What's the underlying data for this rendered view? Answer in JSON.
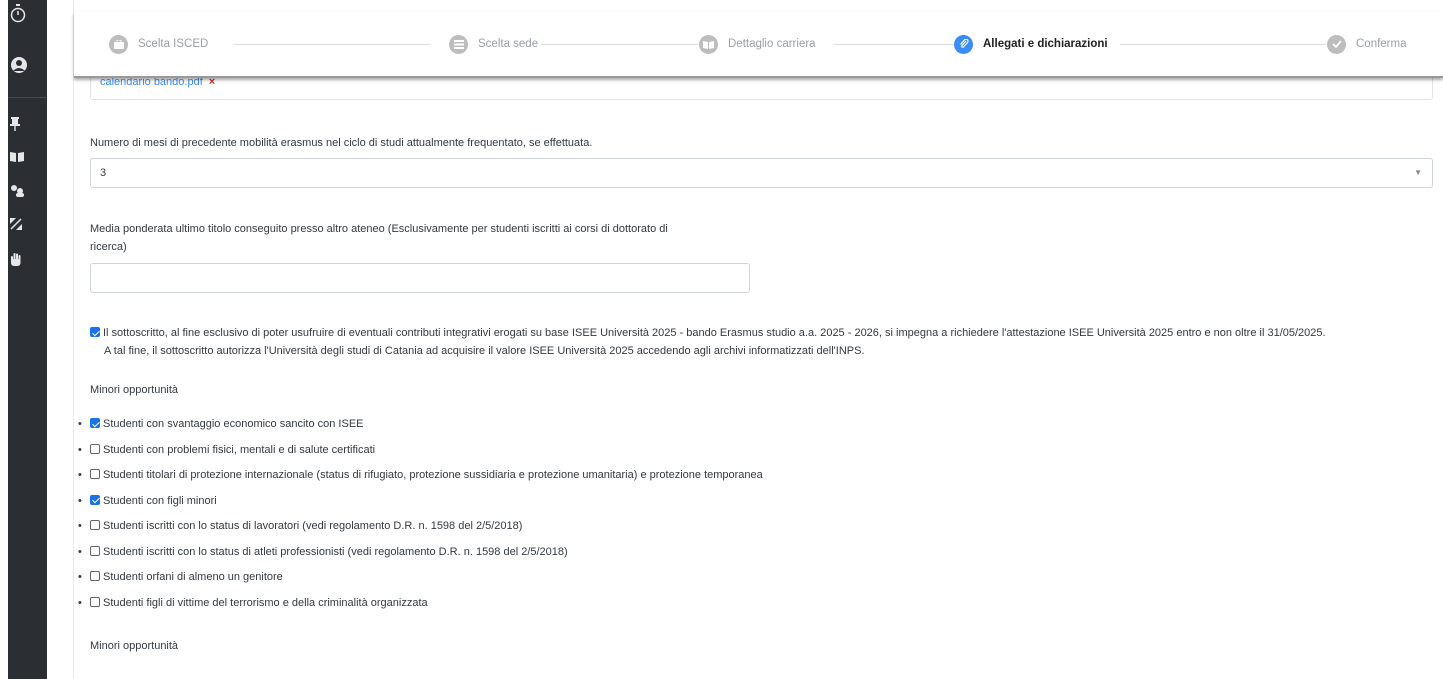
{
  "stepper": {
    "steps": [
      {
        "label": "Scelta ISCED",
        "icon": "briefcase-icon",
        "active": false
      },
      {
        "label": "Scelta sede",
        "icon": "list-icon",
        "active": false
      },
      {
        "label": "Dettaglio carriera",
        "icon": "book-icon",
        "active": false
      },
      {
        "label": "Allegati e dichiarazioni",
        "icon": "paperclip-icon",
        "active": true
      },
      {
        "label": "Conferma",
        "icon": "check-icon",
        "active": false
      }
    ]
  },
  "attachments": {
    "file_name": "calendario bando.pdf",
    "remove_glyph": "×"
  },
  "erasmus_months": {
    "label": "Numero di mesi di precedente mobilità erasmus nel ciclo di studi attualmente frequentato, se effettuata.",
    "value": "3"
  },
  "weighted_average": {
    "label_line1": "Media ponderata ultimo titolo conseguito presso altro ateneo (Esclusivamente per studenti iscritti ai corsi di dottorato di",
    "label_line2": "ricerca)",
    "value": ""
  },
  "declaration": {
    "checked": true,
    "line1": "Il sottoscritto, al fine esclusivo di poter usufruire di eventuali contributi integrativi erogati su base ISEE Università 2025 - bando Erasmus studio a.a. 2025 - 2026, si impegna a richiedere l'attestazione ISEE Università 2025 entro e non oltre il 31/05/2025.",
    "line2": "A tal fine, il sottoscritto autorizza l'Università degli studi di Catania ad acquisire il valore ISEE Università 2025 accedendo agli archivi informatizzati dell'INPS."
  },
  "minori_opportunita": {
    "heading": "Minori opportunità",
    "items": [
      {
        "label": "Studenti con svantaggio economico sancito con ISEE",
        "checked": true
      },
      {
        "label": "Studenti con problemi fisici, mentali e di salute certificati",
        "checked": false
      },
      {
        "label": "Studenti titolari di protezione internazionale (status di rifugiato, protezione sussidiaria e protezione umanitaria) e protezione temporanea",
        "checked": false
      },
      {
        "label": "Studenti con figli minori",
        "checked": true
      },
      {
        "label": "Studenti iscritti con lo status di lavoratori (vedi regolamento D.R. n. 1598 del 2/5/2018)",
        "checked": false
      },
      {
        "label": "Studenti iscritti con lo status di atleti professionisti (vedi regolamento D.R. n. 1598 del 2/5/2018)",
        "checked": false
      },
      {
        "label": "Studenti orfani di almeno un genitore",
        "checked": false
      },
      {
        "label": "Studenti figli di vittime del terrorismo e della criminalità organizzata",
        "checked": false
      }
    ],
    "heading2": "Minori opportunità"
  },
  "sidebar": {
    "icons": [
      "timer-icon",
      "user-avatar-icon",
      "pin-icon",
      "book-open-icon",
      "users-icon",
      "expand-icon",
      "hand-icon"
    ]
  },
  "colors": {
    "accent": "#3b8cf5",
    "sidebar_bg": "#2b2f33",
    "remove": "#e02424"
  }
}
